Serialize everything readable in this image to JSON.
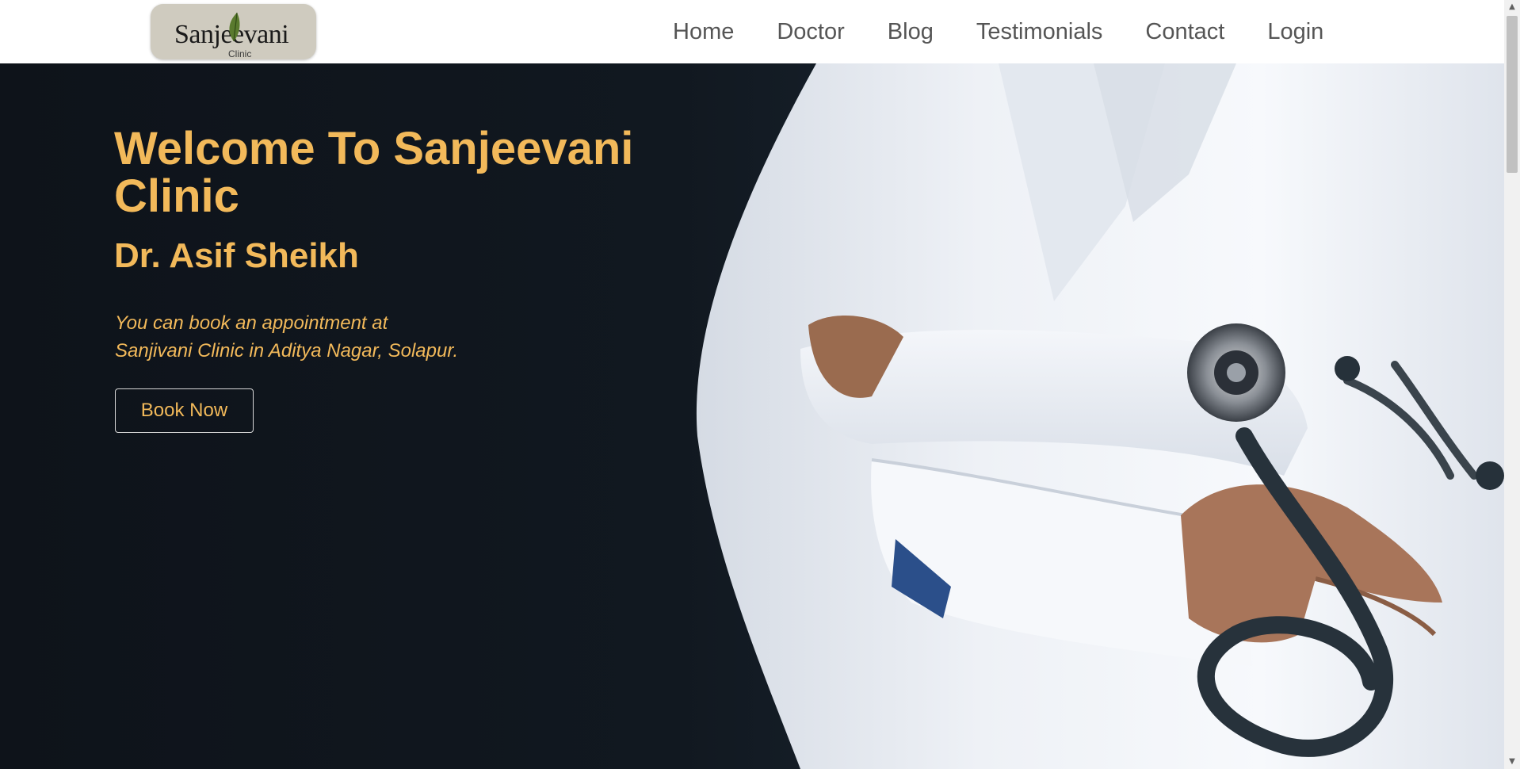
{
  "header": {
    "logo": {
      "name": "Sanjeevani",
      "subtitle": "Clinic"
    },
    "nav": [
      {
        "label": "Home"
      },
      {
        "label": "Doctor"
      },
      {
        "label": "Blog"
      },
      {
        "label": "Testimonials"
      },
      {
        "label": "Contact"
      },
      {
        "label": "Login"
      }
    ]
  },
  "hero": {
    "title": "Welcome To Sanjeevani Clinic",
    "doctor": "Dr. Asif Sheikh",
    "description_line1": "You can book an appointment at",
    "description_line2": "Sanjivani Clinic in Aditya Nagar, Solapur.",
    "cta_label": "Book Now",
    "image_icon": "doctor-with-stethoscope"
  },
  "colors": {
    "accent": "#f2b95a",
    "hero_background": "#111820",
    "nav_text": "#555555",
    "logo_background": "#cfcbbf",
    "coat": "#eef1f6"
  }
}
